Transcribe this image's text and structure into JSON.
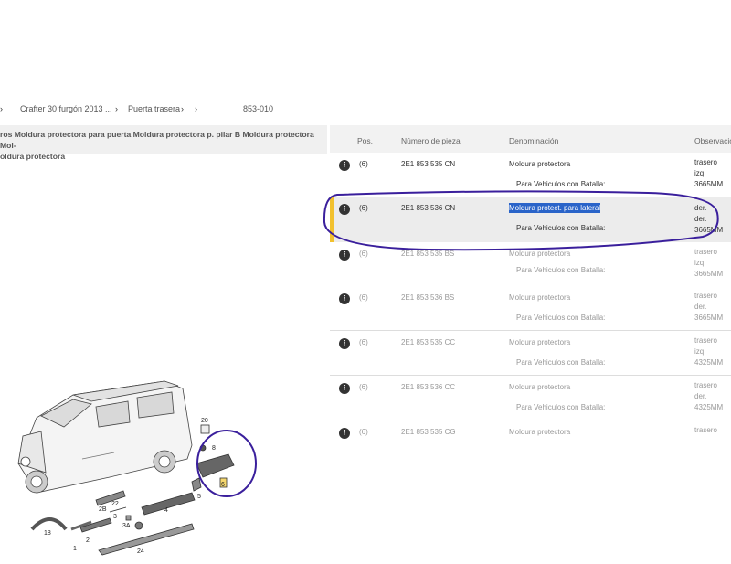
{
  "breadcrumb": {
    "items": [
      "Crafter 30 furgón 2013 ...",
      "Puerta trasera",
      "853-010"
    ]
  },
  "diagram": {
    "title": "ros Moldura protectora para puerta Moldura protectora p. pilar B Moldura protectora Mol-\noldura protectora",
    "callouts": [
      "20",
      "8",
      "6",
      "5",
      "4",
      "3",
      "3A",
      "2B",
      "22",
      "18",
      "1",
      "2",
      "24"
    ]
  },
  "table": {
    "headers": [
      "Pos.",
      "Número de pieza",
      "Denominación",
      "Observacio"
    ],
    "rows": [
      {
        "pos": "(6)",
        "part": "2E1 853 535 CN",
        "name": "Moldura protectora",
        "sub": "Para Vehiculos con Batalla:",
        "obs": [
          "trasero",
          "izq.",
          "3665MM"
        ]
      },
      {
        "pos": "(6)",
        "part": "2E1 853 536 CN",
        "name": "Moldura protect. para lateral",
        "sub": "Para Vehiculos con Batalla:",
        "obs": [
          "der.",
          "der.",
          "3665MM"
        ]
      },
      {
        "pos": "(6)",
        "part": "2E1 853 535 BS",
        "name": "Moldura protectora",
        "sub": "Para Vehiculos con Batalla:",
        "obs": [
          "trasero",
          "izq.",
          "3665MM"
        ]
      },
      {
        "pos": "(6)",
        "part": "2E1 853 536 BS",
        "name": "Moldura protectora",
        "sub": "Para Vehiculos con Batalla:",
        "obs": [
          "trasero",
          "der.",
          "3665MM"
        ]
      },
      {
        "pos": "(6)",
        "part": "2E1 853 535 CC",
        "name": "Moldura protectora",
        "sub": "Para Vehiculos con Batalla:",
        "obs": [
          "trasero",
          "izq.",
          "4325MM"
        ]
      },
      {
        "pos": "(6)",
        "part": "2E1 853 536 CC",
        "name": "Moldura protectora",
        "sub": "Para Vehiculos con Batalla:",
        "obs": [
          "trasero",
          "der.",
          "4325MM"
        ]
      },
      {
        "pos": "(6)",
        "part": "2E1 853 535 CG",
        "name": "Moldura protectora",
        "sub": "",
        "obs": [
          "trasero",
          "",
          ""
        ]
      }
    ]
  },
  "colors": {
    "accent": "#f2c12e",
    "annotation": "#3a1f9c",
    "selection": "#2a64c9"
  }
}
